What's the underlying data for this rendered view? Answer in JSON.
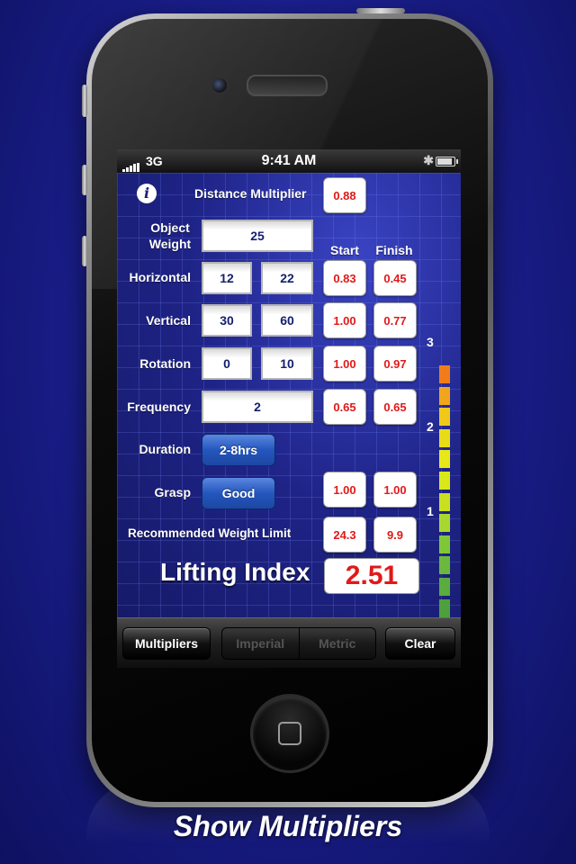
{
  "status_bar": {
    "network": "3G",
    "time": "9:41 AM"
  },
  "header": {
    "distance_label": "Distance Multiplier",
    "distance_value": "0.88"
  },
  "columns": {
    "start": "Start",
    "finish": "Finish"
  },
  "object_weight": {
    "label": "Object Weight",
    "value": "25"
  },
  "horizontal": {
    "label": "Horizontal",
    "start_input": "12",
    "finish_input": "22",
    "start_mult": "0.83",
    "finish_mult": "0.45"
  },
  "vertical": {
    "label": "Vertical",
    "start_input": "30",
    "finish_input": "60",
    "start_mult": "1.00",
    "finish_mult": "0.77"
  },
  "rotation": {
    "label": "Rotation",
    "start_input": "0",
    "finish_input": "10",
    "start_mult": "1.00",
    "finish_mult": "0.97"
  },
  "frequency": {
    "label": "Frequency",
    "value": "2",
    "start_mult": "0.65",
    "finish_mult": "0.65"
  },
  "duration": {
    "label": "Duration",
    "value": "2-8hrs"
  },
  "grasp": {
    "label": "Grasp",
    "value": "Good",
    "start_mult": "1.00",
    "finish_mult": "1.00"
  },
  "rwl": {
    "label": "Recommended Weight Limit",
    "start": "24.3",
    "finish": "9.9"
  },
  "lifting_index": {
    "label": "Lifting Index",
    "value": "2.51"
  },
  "scale": {
    "ticks": [
      "3",
      "2",
      "1"
    ],
    "level": 2.51,
    "colors": [
      "#f07d1a",
      "#f0a51a",
      "#f0c81a",
      "#e8dc18",
      "#e8e818",
      "#d8e818",
      "#c8e020",
      "#a8d830",
      "#7ec838",
      "#6ab83c",
      "#5aac3c",
      "#4ea03c",
      "#449838"
    ]
  },
  "toolbar": {
    "multipliers": "Multipliers",
    "imperial": "Imperial",
    "metric": "Metric",
    "clear": "Clear"
  },
  "caption": "Show Multipliers"
}
